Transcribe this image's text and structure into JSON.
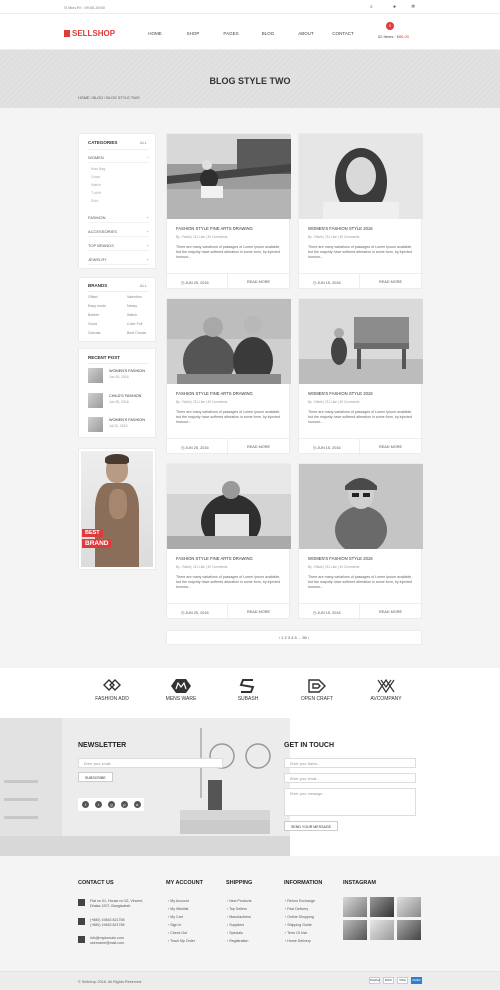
{
  "topbar": {
    "hours": "⊙ Mon-Fri : 09:00-19:00"
  },
  "header": {
    "logo": "SELLSHOP",
    "nav": [
      "HOME",
      "SHOP",
      "PAGES",
      "BLOG",
      "ABOUT",
      "CONTACT"
    ],
    "cart_count": "0",
    "cart_items": "02 Items : ",
    "cart_total": "$86.00"
  },
  "banner": {
    "title": "BLOG STYLE TWO",
    "crumb": "HOME  /  BLOG  /  BLOG STYLE TWO"
  },
  "sidebar": {
    "categories_title": "CATEGORIES",
    "all": "ALL",
    "women": "WOMEN",
    "women_sub": [
      "Man Bag",
      "Gown",
      "Watch",
      "T-shirt",
      "Shirt"
    ],
    "cats": [
      "FASHION",
      "ACCESSORIES",
      "TOP BRANDS",
      "JEWELRY"
    ],
    "brands_title": "BRANDS",
    "brands": [
      [
        "Offset",
        "Valentino"
      ],
      [
        "Easy mode",
        "Nessy"
      ],
      [
        "Bobble",
        "Watch"
      ],
      [
        "Gucci",
        "Color Full"
      ],
      [
        "Garcias",
        "Best Choice"
      ]
    ],
    "recent_title": "RECENT POST",
    "recent": [
      {
        "title": "WOMEN'S FASHION",
        "date": "Jun 25, 2016"
      },
      {
        "title": "CHILD'S FASHION",
        "date": "Jun 28, 2016"
      },
      {
        "title": "WOMEN'S FASHION",
        "date": "Jul 22, 2016"
      }
    ],
    "ad_best": "BEST",
    "ad_brand": "BRAND"
  },
  "posts": [
    {
      "title": "FASHION STYLE FINE ARTS DRAWING",
      "meta": "By : Rakib | 211 Like | 49 Comments",
      "excerpt": "There are many variations of passages of Lorem Ipsum available, but the majority have suffered alteration in some form, by injected humour...",
      "date": "◷ JUN 25, 2016",
      "more": "READ MORE"
    },
    {
      "title": "WOMEN'S FASHION STYLE 2016",
      "meta": "By : Rakib | 211 Like | 49 Comments",
      "excerpt": "There are many variations of passages of Lorem Ipsum available, but the majority have suffered alteration in some form, by injected humour...",
      "date": "◷ JUN 15, 2016",
      "more": "READ MORE"
    },
    {
      "title": "FASHION STYLE FINE ARTS DRAWING",
      "meta": "By : Rakib | 211 Like | 49 Comments",
      "excerpt": "There are many variations of passages of Lorem Ipsum available, but the majority have suffered alteration in some form, by injected humour...",
      "date": "◷ JUN 25, 2016",
      "more": "READ MORE"
    },
    {
      "title": "WOMEN'S FASHION STYLE 2016",
      "meta": "By : Rakib | 211 Like | 49 Comments",
      "excerpt": "There are many variations of passages of Lorem Ipsum available, but the majority have suffered alteration in some form, by injected humour...",
      "date": "◷ JUN 15, 2016",
      "more": "READ MORE"
    },
    {
      "title": "FASHION STYLE FINE ARTS DRAWING",
      "meta": "By : Rakib | 211 Like | 49 Comments",
      "excerpt": "There are many variations of passages of Lorem Ipsum available, but the majority have suffered alteration in some form, by injected humour...",
      "date": "◷ JUN 25, 2016",
      "more": "READ MORE"
    },
    {
      "title": "WOMEN'S FASHION STYLE 2016",
      "meta": "By : Rakib | 211 Like | 49 Comments",
      "excerpt": "There are many variations of passages of Lorem Ipsum available, but the majority have suffered alteration in some form, by injected humour...",
      "date": "◷ JUN 15, 2016",
      "more": "READ MORE"
    }
  ],
  "pager": {
    "text": "‹   1  2  3  4  5  ...  55   ›"
  },
  "brands": [
    "FASHION ADD",
    "MENS WARE",
    "SUBASH",
    "OPEN CRAFT",
    "AVCOMPANY"
  ],
  "newsletter": {
    "title": "NEWSLETTER",
    "placeholder": "Enter your email...",
    "button": "SUBSCRIBE"
  },
  "contact": {
    "title": "GET IN TOUCH",
    "name": "Enter your Name...",
    "email": "Enter your email...",
    "message": "Enter your message...",
    "button": "SEND YOUR MESSAGE"
  },
  "footer": {
    "contact_title": "CONTACT US",
    "address": "Flat no 01, House no 02, Vincent, Dhaka 1207, Bangladesh",
    "phone1": "(+880) 19463 821758",
    "phone2": "(+880) 19463 821758",
    "email1": "info@mydomain.com",
    "email2": "username@mail.com",
    "account_title": "MY ACCOUNT",
    "account": [
      "My Account",
      "My Wishlist",
      "My Cart",
      "Sign In",
      "Check Out",
      "Track My Order"
    ],
    "shipping_title": "SHIPPING",
    "shipping": [
      "New Products",
      "Top Sellers",
      "Manufactirers",
      "Suppliers",
      "Specials",
      "Registration"
    ],
    "info_title": "INFORMATION",
    "info": [
      "Return Exchange",
      "Fast Delivery",
      "Online Shopping",
      "Shipping Guide",
      "Term Of Use",
      "Home Delivery"
    ],
    "instagram_title": "INSTAGRAM"
  },
  "copyright": "© Sellshop 2016. All Rights Reserved.",
  "payments": [
    "PayPal",
    "DISC",
    "VISA",
    "AMEX"
  ]
}
